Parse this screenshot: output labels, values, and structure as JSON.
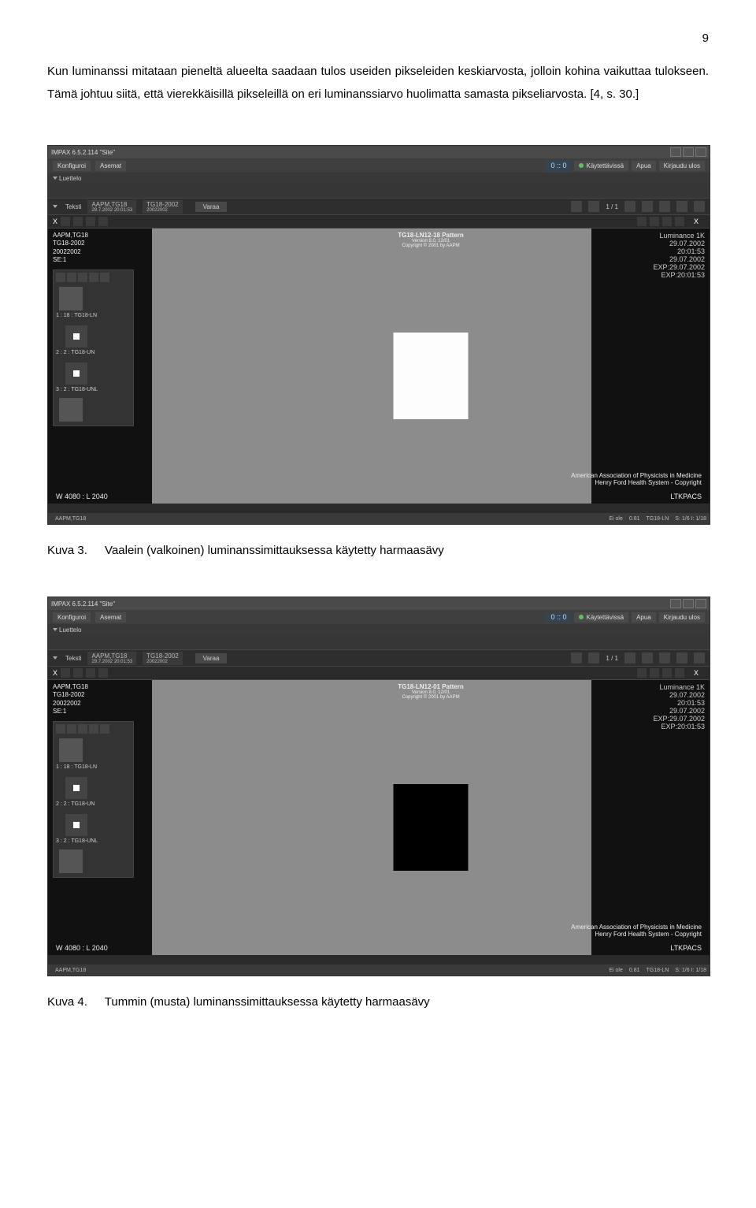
{
  "page_number": "9",
  "paragraph": "Kun luminanssi mitataan pieneltä alueelta saadaan tulos useiden pikseleiden keskiarvosta, jolloin kohina vaikuttaa tulokseen. Tämä johtuu siitä, että vierekkäisillä pikseleillä on eri luminanssiarvo huolimatta samasta pikseliarvosta. [4, s. 30.]",
  "app": {
    "title": "IMPAX 6.5.2.114  \"Site\"",
    "menu": {
      "konfiguroi": "Konfiguroi",
      "asemat": "Asemat",
      "zero": "0 :: 0",
      "kaytettavissa": "Käytettävissä",
      "apua": "Apua",
      "kirjaudu": "Kirjaudu ulos"
    },
    "subheader": "Luettelo",
    "teksti": "Teksti",
    "study_chip1": "AAPM,TG18",
    "study_chip1_line2": "29.7.2002  20:01:53",
    "study_chip2": "TG18-2002",
    "study_chip2_line2": "20022002",
    "varaa": "Varaa",
    "nav_counter": "1 / 1",
    "left": {
      "l1": "AAPM,TG18",
      "l2": "TG18-2002",
      "l3": "20022002",
      "l4": "SE:1",
      "thumb1": "1 : 18 : TG18-LN",
      "thumb2": "2 : 2 : TG18-UN",
      "thumb3": "3 : 2 : TG18-UNL"
    },
    "right": {
      "r1": "Luminance 1K",
      "r2": "29.07.2002",
      "r3": "20:01:53",
      "r4": "29.07.2002",
      "r5": "EXP:29.07.2002",
      "r6": "EXP:20:01:53"
    },
    "viewer_title_a": "TG18-LN12-18 Pattern",
    "viewer_title_b": "TG18-LN12-01 Pattern",
    "viewer_sub1": "Version 8.0, 12/01",
    "viewer_sub2": "Copyright © 2001 by AAPM",
    "copyright1": "American Association of Physicists in Medicine",
    "copyright2": "Henry Ford Health System - Copyright",
    "wl": "W 4080 : L 2040",
    "ltk": "LTKPACS",
    "status_left": "AAPM,TG18",
    "status_r1": "Ei ole",
    "status_r2": "0.81",
    "status_r3": "TG18-LN",
    "status_r4": "S: 1/6  I: 1/18"
  },
  "captions": {
    "c3_label": "Kuva 3.",
    "c3_text": "Vaalein (valkoinen) luminanssimittauksessa käytetty harmaasävy",
    "c4_label": "Kuva 4.",
    "c4_text": "Tummin (musta) luminanssimittauksessa käytetty harmaasävy"
  }
}
